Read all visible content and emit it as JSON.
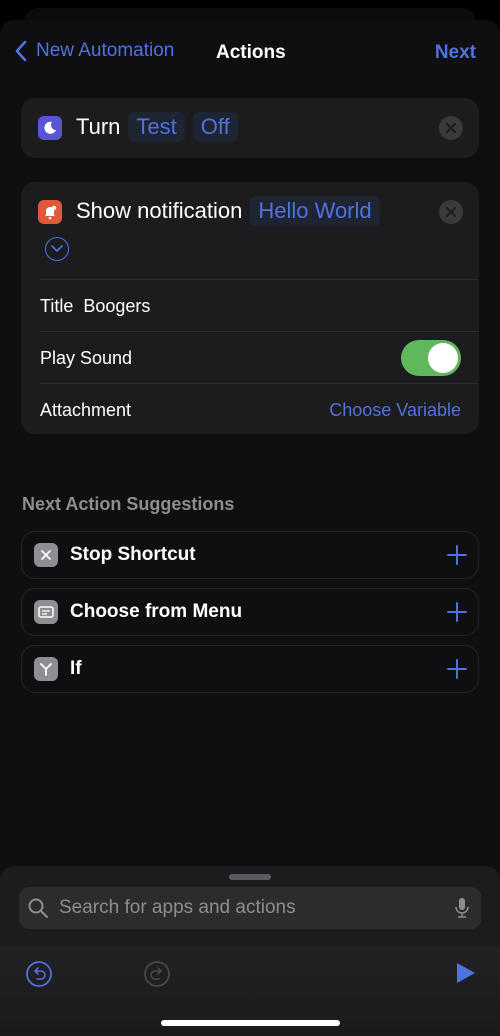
{
  "nav": {
    "back_label": "New Automation",
    "title": "Actions",
    "next_label": "Next"
  },
  "actions": [
    {
      "icon": "moon-icon",
      "icon_color": "#5856d6",
      "verb": "Turn",
      "tokens": [
        "Test",
        "Off"
      ]
    },
    {
      "icon": "notification-bell-icon",
      "icon_color": "#e0583a",
      "verb": "Show notification",
      "tokens": [
        "Hello World"
      ],
      "params": {
        "title_label": "Title",
        "title_value": "Boogers",
        "play_sound_label": "Play Sound",
        "play_sound_on": true,
        "attachment_label": "Attachment",
        "attachment_value": "Choose Variable"
      }
    }
  ],
  "suggestions": {
    "title": "Next Action Suggestions",
    "items": [
      {
        "label": "Stop Shortcut",
        "icon": "stop-x-icon"
      },
      {
        "label": "Choose from Menu",
        "icon": "menu-icon"
      },
      {
        "label": "If",
        "icon": "branch-icon"
      }
    ]
  },
  "search": {
    "placeholder": "Search for apps and actions",
    "value": ""
  },
  "colors": {
    "accent": "#4f72e0",
    "toggle_on": "#5fb85a"
  }
}
